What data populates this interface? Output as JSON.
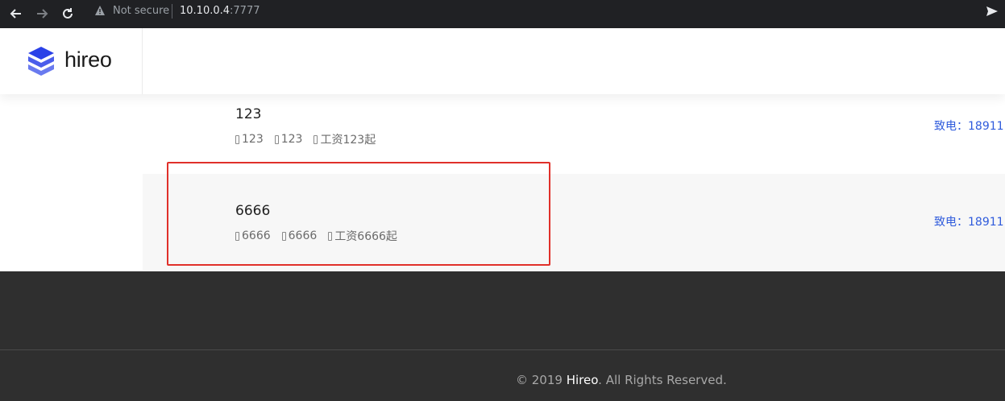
{
  "browser": {
    "security_label": "Not secure",
    "url_host": "10.10.0.4",
    "url_port": ":7777"
  },
  "site": {
    "brand": "hireo"
  },
  "jobs": [
    {
      "title": "123",
      "company": "123",
      "location": "123",
      "salary": "工资123起",
      "contact": "致电：18911"
    },
    {
      "title": "6666",
      "company": "6666",
      "location": "6666",
      "salary": "工资6666起",
      "contact": "致电：18911"
    }
  ],
  "footer": {
    "copyright_prefix": "© 2019",
    "brand": "Hireo",
    "copyright_suffix": ". All Rights Reserved."
  },
  "colors": {
    "accent": "#2f5bdc",
    "highlight": "#e0302a",
    "footer_bg": "#2f2f2f"
  }
}
